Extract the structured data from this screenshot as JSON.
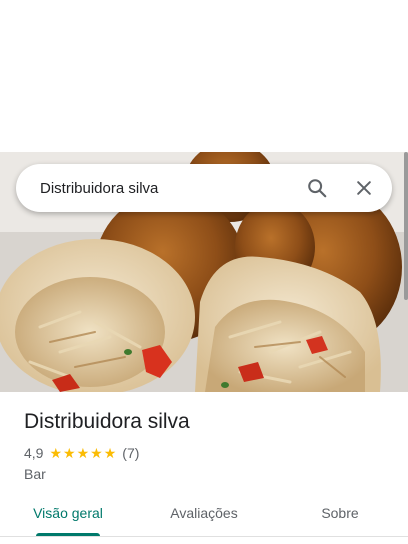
{
  "search": {
    "query": "Distribuidora silva"
  },
  "place": {
    "name": "Distribuidora silva",
    "rating": "4,9",
    "stars": 5,
    "review_count": "(7)",
    "category": "Bar"
  },
  "tabs": [
    {
      "label": "Visão geral",
      "active": true
    },
    {
      "label": "Avaliações",
      "active": false
    },
    {
      "label": "Sobre",
      "active": false
    }
  ],
  "colors": {
    "accent": "#00796b",
    "star": "#fbbc04"
  },
  "icons": [
    "search-icon",
    "close-icon",
    "star-icon"
  ]
}
